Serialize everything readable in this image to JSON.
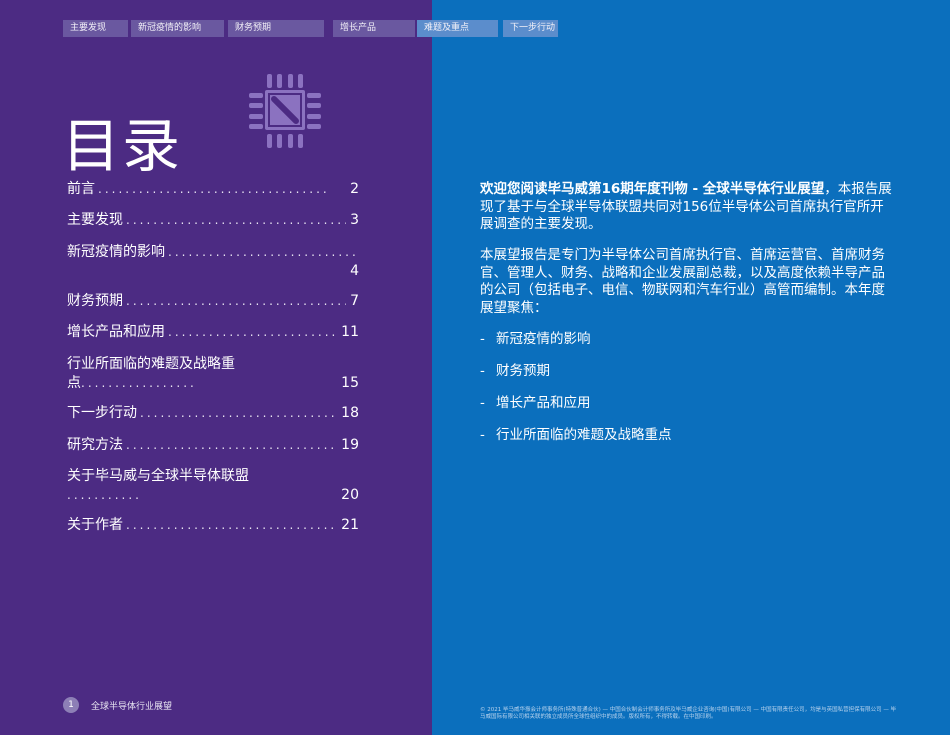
{
  "nav": {
    "tabs": [
      {
        "label": "主要发现"
      },
      {
        "label": "新冠疫情的影响"
      },
      {
        "label": "财务预期"
      },
      {
        "label": "增长产品"
      },
      {
        "label": "难题及重点"
      },
      {
        "label": "下一步行动"
      }
    ]
  },
  "page_title": "目录",
  "toc": [
    {
      "label": "前言",
      "page": "2"
    },
    {
      "label": "主要发现",
      "page": "3"
    },
    {
      "label": "新冠疫情的影响",
      "page": "4"
    },
    {
      "label": "财务预期",
      "page": "7"
    },
    {
      "label": "增长产品和应用",
      "page": "11"
    },
    {
      "label_line1": "行业所面临的难题及战略重",
      "label_line2": "点",
      "page": "15"
    },
    {
      "label": "下一步行动",
      "page": "18"
    },
    {
      "label": "研究方法",
      "page": "19"
    },
    {
      "label": "关于毕马威与全球半导体联盟",
      "page": "20"
    },
    {
      "label": "关于作者",
      "page": "21"
    }
  ],
  "footer": {
    "page_number": "1",
    "publication": "全球半导体行业展望",
    "legal": "© 2021 毕马威华振会计师事务所(特殊普通合伙) — 中国合伙制会计师事务所及毕马威企业咨询(中国)有限公司 — 中国有限责任公司，均是与英国私营担保有限公司 — 毕马威国际有限公司相关联的独立成员所全球性组织中的成员。版权所有，不得转载。在中国印刷。"
  },
  "intro": {
    "bold": "欢迎您阅读毕马威第16期年度刊物 - 全球半导体行业展望",
    "rest": "，本报告展现了基于与全球半导体联盟共同对156位半导体公司首席执行官所开展调查的主要发现。"
  },
  "body2": "本展望报告是专门为半导体公司首席执行官、首席运营官、首席财务官、管理人、财务、战略和企业发展副总裁，以及高度依赖半导产品的公司（包括电子、电信、物联网和汽车行业）高管而编制。本年度展望聚焦：",
  "bullets": [
    {
      "dash": "-",
      "text": "新冠疫情的影响"
    },
    {
      "dash": "-",
      "text": "财务预期"
    },
    {
      "dash": "-",
      "text": "增长产品和应用"
    },
    {
      "dash": "-",
      "text": "行业所面临的难题及战略重点"
    }
  ],
  "colors": {
    "left_bg": "#4c2b83",
    "right_bg": "#0b6fbd",
    "chip": "#8b72c0"
  }
}
